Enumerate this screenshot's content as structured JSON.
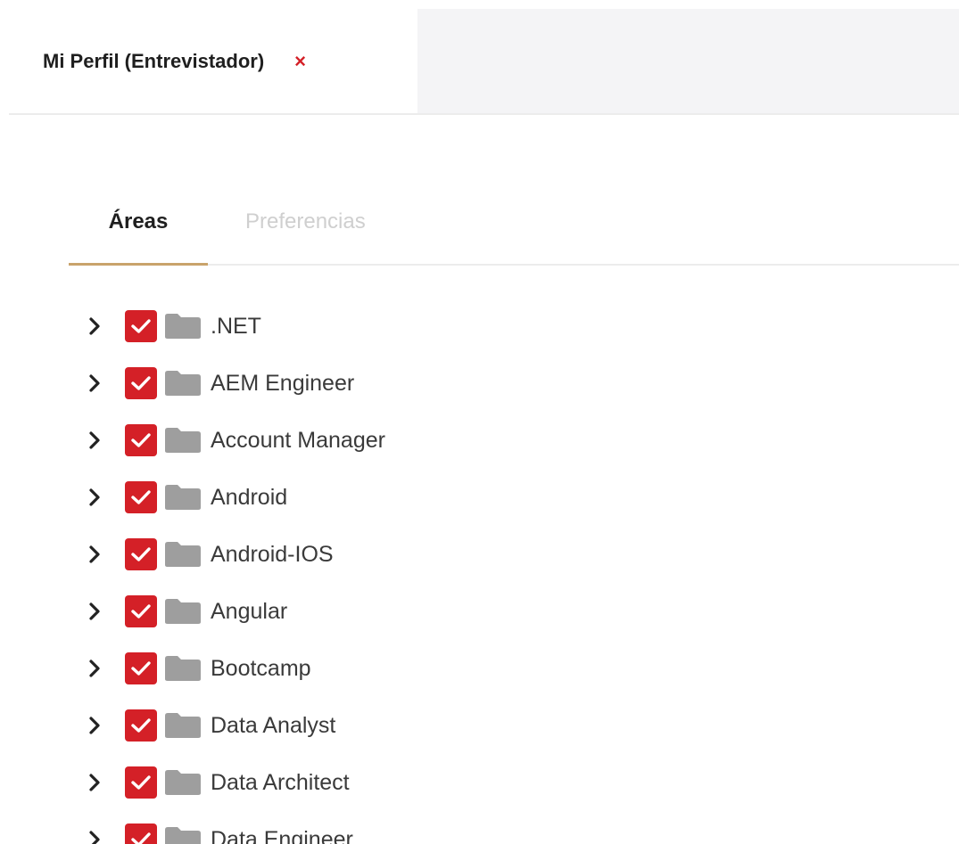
{
  "doc_tab": {
    "title": "Mi Perfil (Entrevistador)",
    "close_symbol": "×",
    "close_color": "#d42027"
  },
  "inner_tabs": [
    {
      "label": "Áreas",
      "active": true
    },
    {
      "label": "Preferencias",
      "active": false
    }
  ],
  "accent_color": "#c9a36b",
  "checkbox_color": "#d42027",
  "folder_color": "#9e9e9e",
  "tree": {
    "items": [
      {
        "label": ".NET",
        "checked": true,
        "icon": "folder-icon"
      },
      {
        "label": "AEM Engineer",
        "checked": true,
        "icon": "folder-icon"
      },
      {
        "label": "Account Manager",
        "checked": true,
        "icon": "folder-icon"
      },
      {
        "label": "Android",
        "checked": true,
        "icon": "folder-icon"
      },
      {
        "label": "Android-IOS",
        "checked": true,
        "icon": "folder-icon"
      },
      {
        "label": "Angular",
        "checked": true,
        "icon": "folder-icon"
      },
      {
        "label": "Bootcamp",
        "checked": true,
        "icon": "folder-icon"
      },
      {
        "label": "Data Analyst",
        "checked": true,
        "icon": "folder-icon"
      },
      {
        "label": "Data Architect",
        "checked": true,
        "icon": "folder-icon"
      },
      {
        "label": "Data Engineer",
        "checked": true,
        "icon": "folder-icon"
      }
    ]
  }
}
